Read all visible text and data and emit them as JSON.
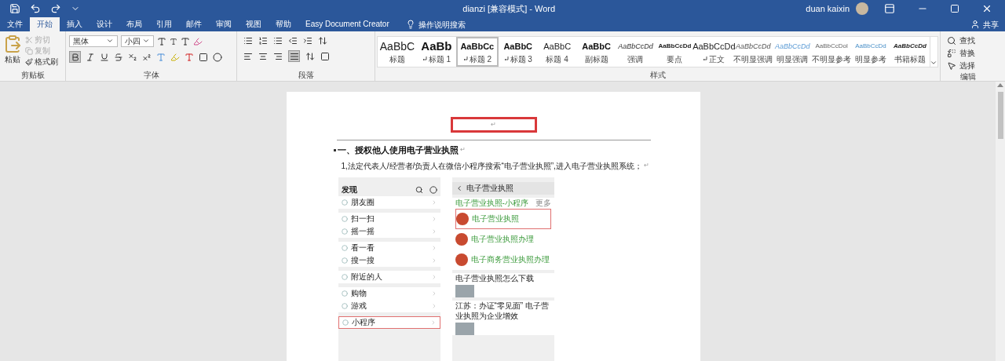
{
  "window": {
    "title": "dianzi [兼容模式] - Word",
    "user": "duan kaixin"
  },
  "tabs": [
    {
      "label": "文件",
      "selected": false
    },
    {
      "label": "开始",
      "selected": true
    },
    {
      "label": "插入",
      "selected": false
    },
    {
      "label": "设计",
      "selected": false
    },
    {
      "label": "布局",
      "selected": false
    },
    {
      "label": "引用",
      "selected": false
    },
    {
      "label": "邮件",
      "selected": false
    },
    {
      "label": "审阅",
      "selected": false
    },
    {
      "label": "视图",
      "selected": false
    },
    {
      "label": "帮助",
      "selected": false
    },
    {
      "label": "Easy Document Creator",
      "selected": false
    }
  ],
  "tell_me": "操作说明搜索",
  "share": "共享",
  "ribbon": {
    "clipboard": {
      "paste": "粘贴",
      "items": [
        {
          "kind": "cut",
          "label": "剪切",
          "disabled": true
        },
        {
          "kind": "copy",
          "label": "复制",
          "disabled": true
        },
        {
          "kind": "painter",
          "label": "格式刷",
          "disabled": false
        }
      ],
      "label": "剪贴板"
    },
    "font": {
      "name": "黑体",
      "size": "小四",
      "bold_on": true,
      "label": "字体"
    },
    "paragraph": {
      "justify_on": true,
      "label": "段落"
    },
    "styles": {
      "items": [
        {
          "preview": "AaBbC",
          "name": "标题",
          "kind": "title",
          "linked": false,
          "selected": false
        },
        {
          "preview": "AaBb",
          "name": "标题 1",
          "kind": "heading1",
          "linked": true,
          "selected": false
        },
        {
          "preview": "AaBbCc",
          "name": "标题 2",
          "kind": "heading",
          "linked": true,
          "selected": true
        },
        {
          "preview": "AaBbC",
          "name": "标题 3",
          "kind": "heading",
          "linked": true,
          "selected": false
        },
        {
          "preview": "AaBbC",
          "name": "标题 4",
          "kind": "plain",
          "linked": false,
          "selected": false
        },
        {
          "preview": "AaBbC",
          "name": "副标题",
          "kind": "heading",
          "linked": false,
          "selected": false
        },
        {
          "preview": "AaBbCcDd",
          "name": "强调",
          "kind": "italic",
          "linked": false,
          "selected": false
        },
        {
          "preview": "AaBbCcDd",
          "name": "要点",
          "kind": "bold",
          "linked": false,
          "selected": false
        },
        {
          "preview": "AaBbCcDd",
          "name": "正文",
          "kind": "plain",
          "linked": true,
          "selected": false
        },
        {
          "preview": "AaBbCcDd",
          "name": "不明显强调",
          "kind": "subtle",
          "linked": false,
          "selected": false
        },
        {
          "preview": "AaBbCcDd",
          "name": "明显强调",
          "kind": "intense",
          "linked": false,
          "selected": false
        },
        {
          "preview": "AaBbCcDol",
          "name": "不明显参考",
          "kind": "subtleref",
          "linked": false,
          "selected": false
        },
        {
          "preview": "AaBbCcDd",
          "name": "明显参考",
          "kind": "intenseref",
          "linked": false,
          "selected": false
        },
        {
          "preview": "AaBbCcDd",
          "name": "书籍标题",
          "kind": "book",
          "linked": false,
          "selected": false
        }
      ],
      "label": "样式"
    },
    "editing": {
      "find": "查找",
      "replace": "替换",
      "select": "选择",
      "label": "编辑"
    }
  },
  "document": {
    "header_mark": "↵",
    "heading": "一、授权他人使用电子营业执照",
    "heading_mark": "↵",
    "paragraph": "1,法定代表人/经营者/负责人在微信小程序搜索“电子营业执照”,进入电子营业执照系统；",
    "paragraph_mark": "↵",
    "phone_discover": {
      "title": "发现",
      "groups": [
        [
          {
            "label": "朋友圈",
            "highlighted": false
          }
        ],
        [
          {
            "label": "扫一扫",
            "highlighted": false
          },
          {
            "label": "摇一摇",
            "highlighted": false
          }
        ],
        [
          {
            "label": "看一看",
            "highlighted": false
          },
          {
            "label": "搜一搜",
            "highlighted": false
          }
        ],
        [
          {
            "label": "附近的人",
            "highlighted": false
          }
        ],
        [
          {
            "label": "购物",
            "highlighted": false
          },
          {
            "label": "游戏",
            "highlighted": false
          }
        ],
        [
          {
            "label": "小程序",
            "highlighted": true
          }
        ]
      ]
    },
    "phone_search": {
      "query": "电子营业执照",
      "section": "电子营业执照-小程序",
      "more": "更多",
      "results": [
        {
          "title": "电子营业执照",
          "highlighted": true
        },
        {
          "title": "电子营业执照办理",
          "highlighted": false
        },
        {
          "title": "电子商务营业执照办理",
          "highlighted": false
        }
      ],
      "articles": [
        {
          "title": "电子营业执照怎么下载"
        },
        {
          "title": "江苏：办证“零见面” 电子营业执照为企业增效"
        }
      ]
    }
  }
}
